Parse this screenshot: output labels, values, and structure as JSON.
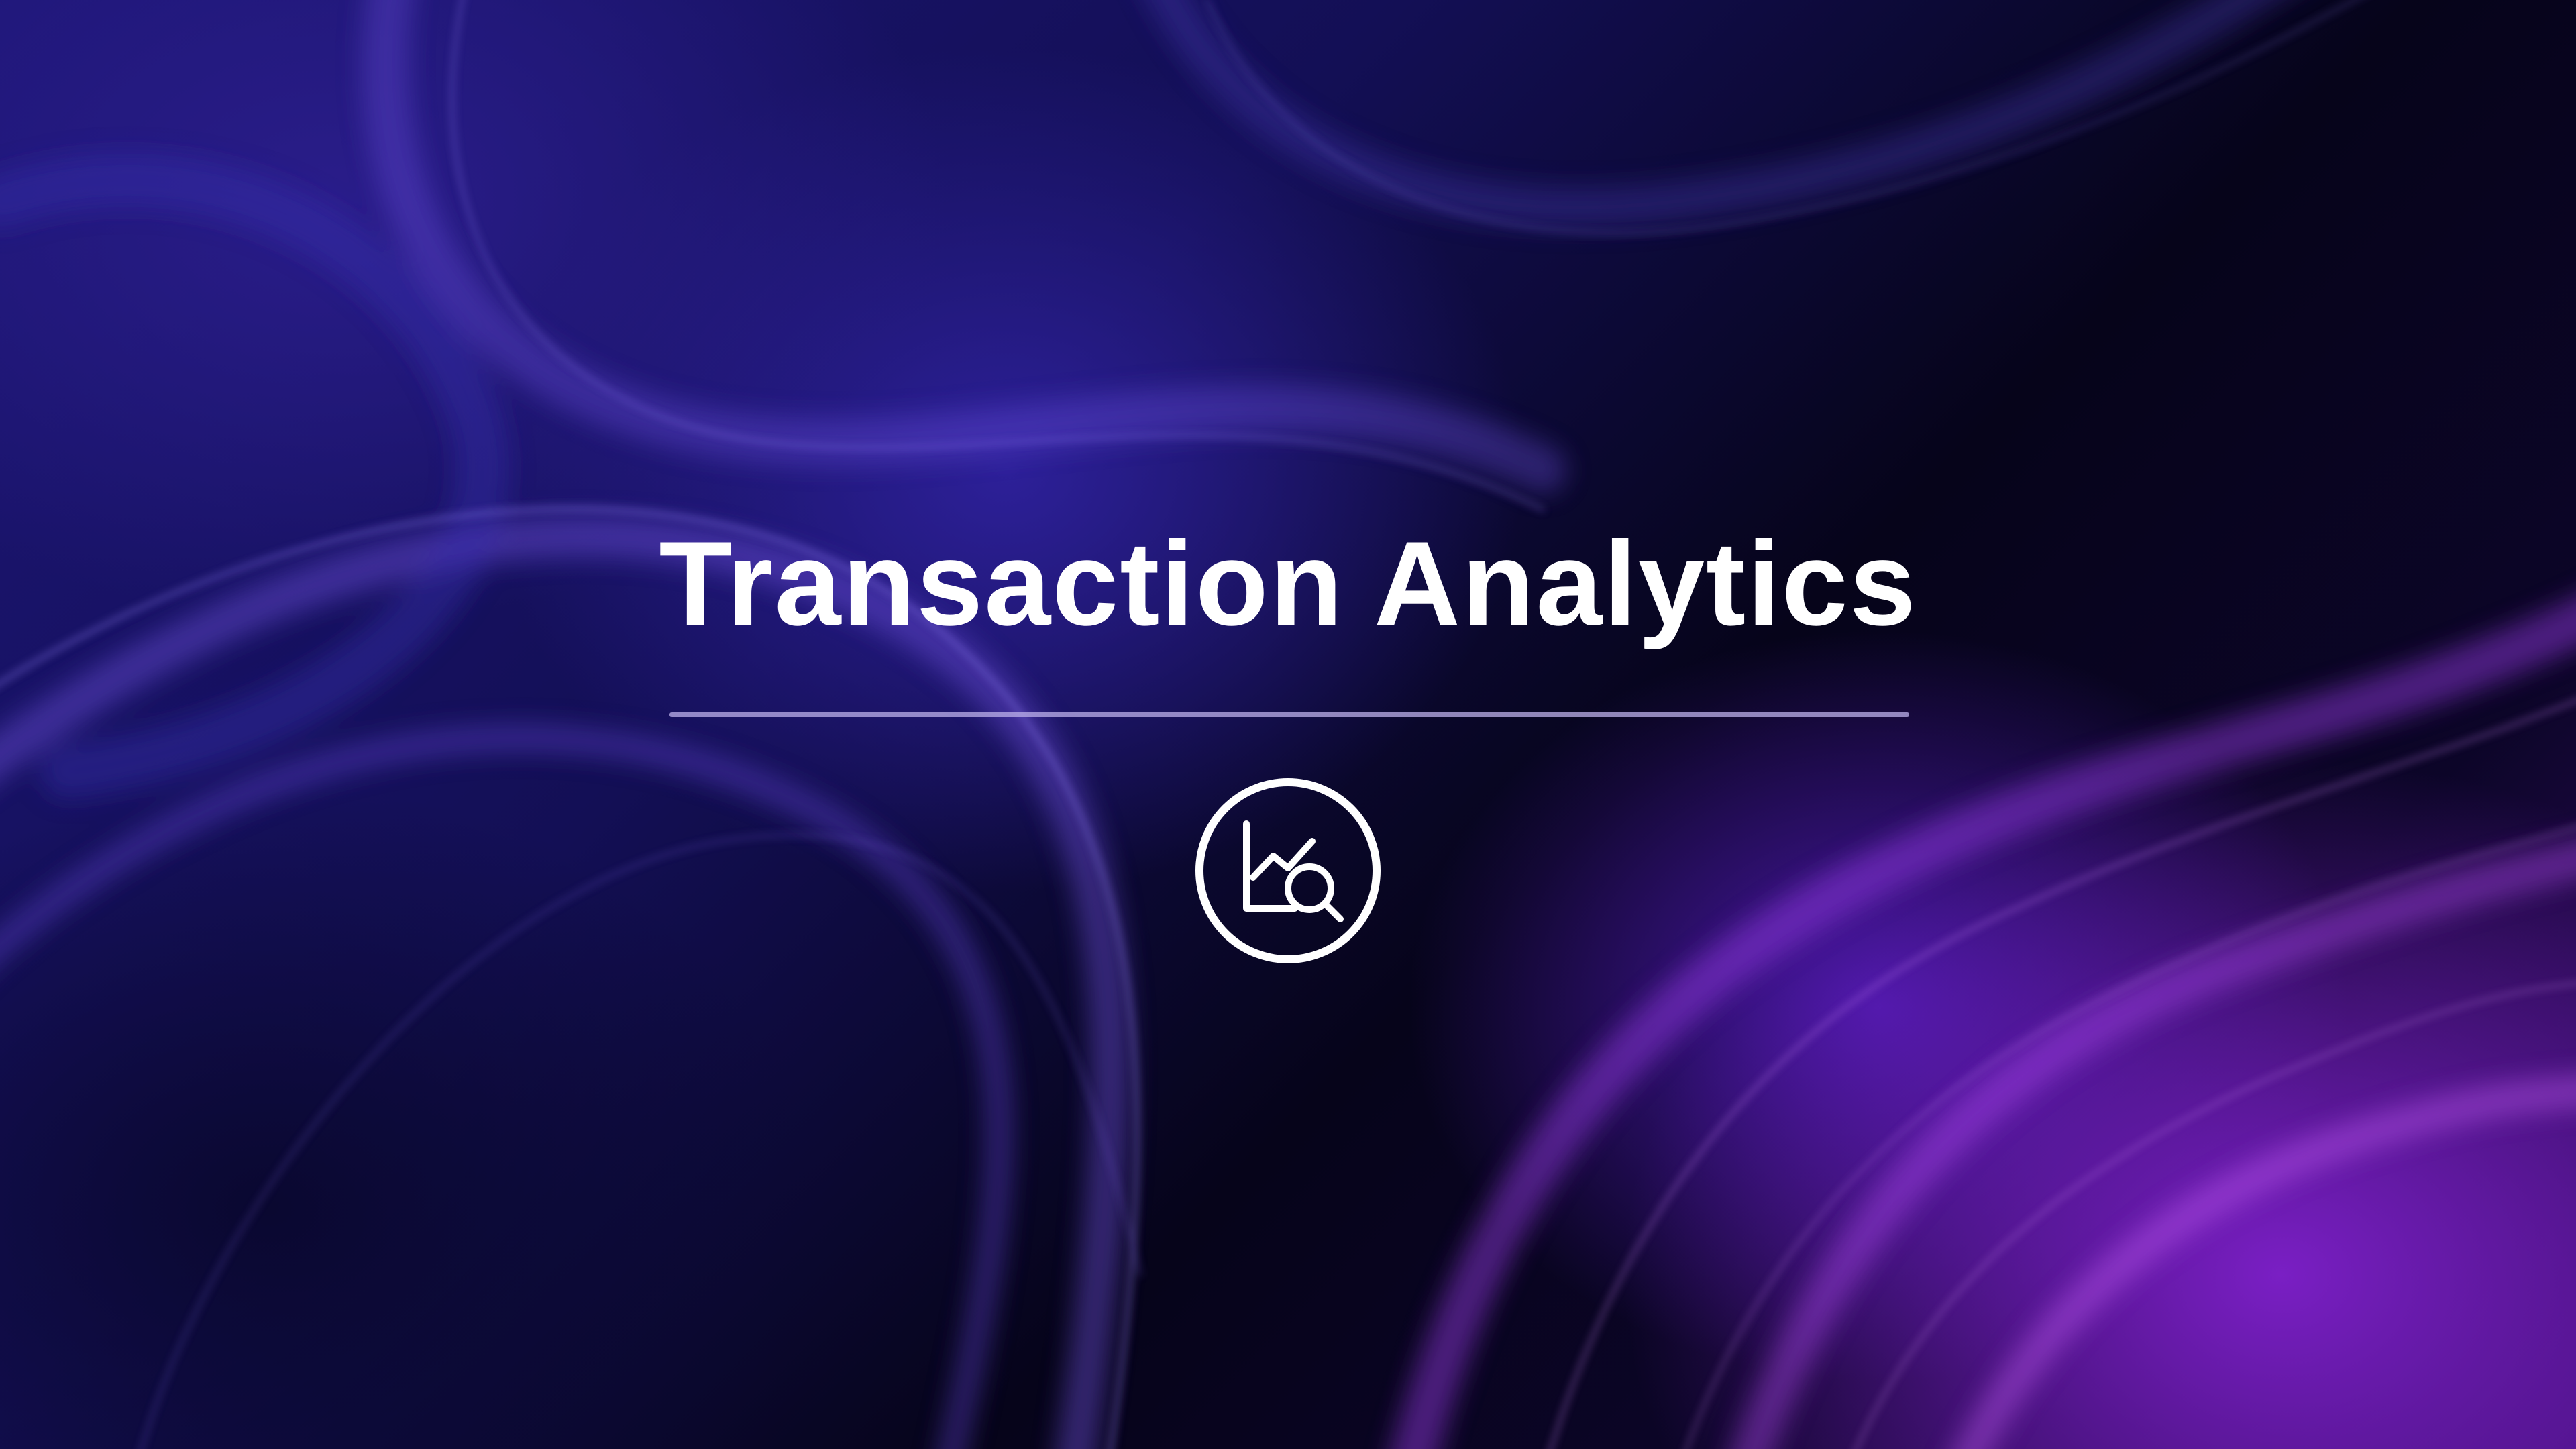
{
  "slide": {
    "title": "Transaction Analytics",
    "icon": "analytics-search-icon",
    "colors": {
      "background_primary": "#1d1677",
      "background_accent": "#7a1fc4",
      "title_text": "#ffffff",
      "divider": "#beb2eb"
    }
  }
}
